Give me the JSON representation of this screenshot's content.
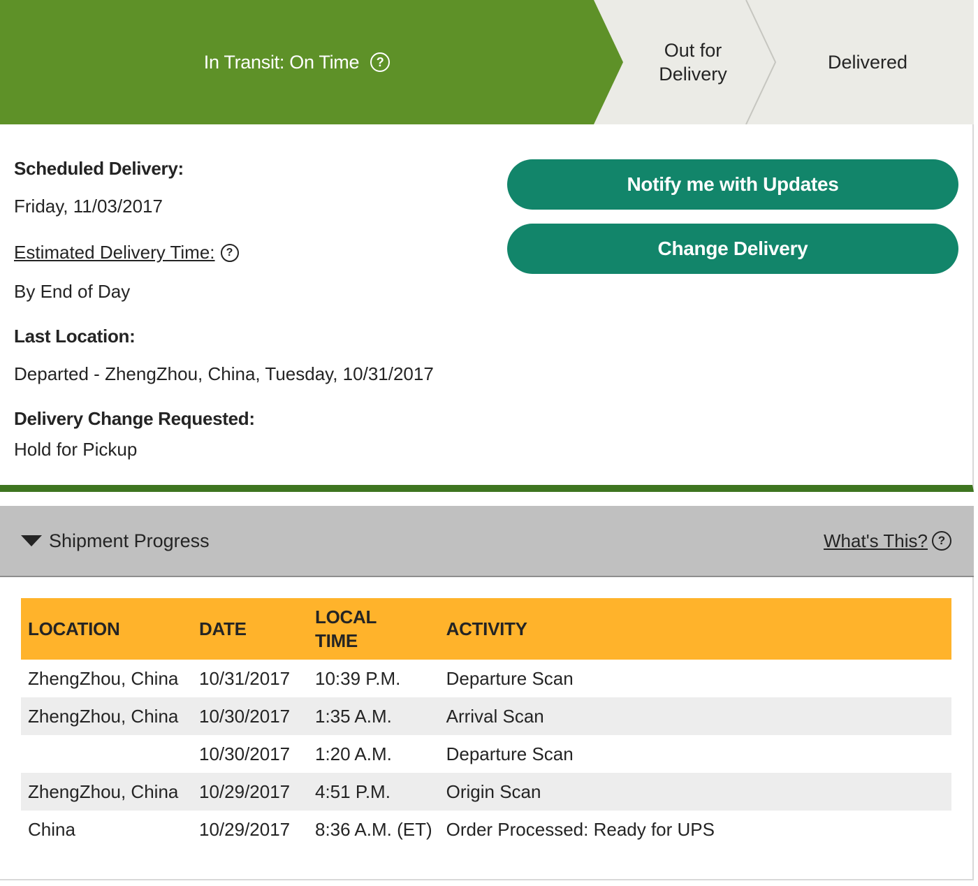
{
  "stepper": {
    "active_label": "In Transit: On Time",
    "out_for_delivery_line1": "Out for",
    "out_for_delivery_line2": "Delivery",
    "delivered_label": "Delivered"
  },
  "details": {
    "scheduled_label": "Scheduled Delivery:",
    "scheduled_value": "Friday, 11/03/2017",
    "estimated_label": "Estimated Delivery Time:",
    "estimated_value": "By End of Day",
    "last_location_label": "Last Location:",
    "last_location_value": "Departed - ZhengZhou, China, Tuesday, 10/31/2017",
    "change_requested_label": "Delivery Change Requested:",
    "change_requested_value": "Hold for Pickup"
  },
  "actions": {
    "notify_label": "Notify me with Updates",
    "change_label": "Change Delivery"
  },
  "progress": {
    "title": "Shipment Progress",
    "whats_this": "What's This?",
    "headers": {
      "location": "LOCATION",
      "date": "DATE",
      "time_line1": "LOCAL",
      "time_line2": "TIME",
      "activity": "ACTIVITY"
    },
    "rows": [
      {
        "location": "ZhengZhou,  China",
        "date": "10/31/2017",
        "time": "10:39 P.M.",
        "activity": "Departure Scan"
      },
      {
        "location": "ZhengZhou,  China",
        "date": "10/30/2017",
        "time": "1:35 A.M.",
        "activity": "Arrival Scan"
      },
      {
        "location": "",
        "date": "10/30/2017",
        "time": "1:20 A.M.",
        "activity": "Departure Scan"
      },
      {
        "location": "ZhengZhou,  China",
        "date": "10/29/2017",
        "time": "4:51 P.M.",
        "activity": "Origin Scan"
      },
      {
        "location": "China",
        "date": "10/29/2017",
        "time": "8:36 A.M. (ET)",
        "activity": "Order Processed: Ready for UPS"
      }
    ]
  },
  "colors": {
    "active_step": "#5e9128",
    "inactive_step": "#ebebe6",
    "button": "#12856a",
    "table_header": "#ffb32b",
    "section_header": "#c0c0c0",
    "details_border": "#3e7520"
  },
  "icons": {
    "help": "question-circle-icon",
    "collapse": "triangle-down-icon"
  }
}
